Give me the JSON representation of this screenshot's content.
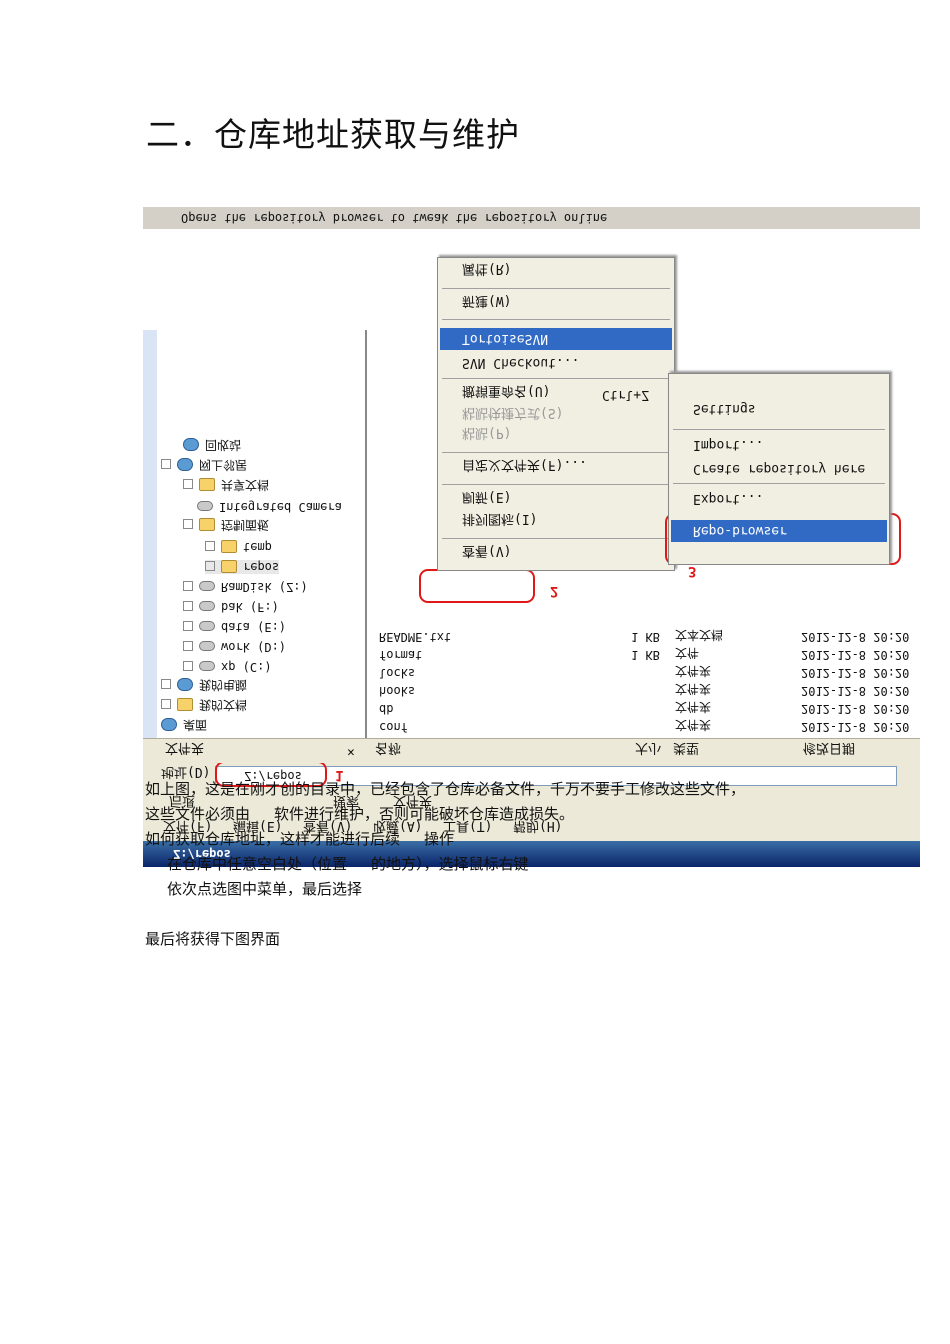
{
  "heading": "二．仓库地址获取与维护",
  "screenshot": {
    "tooltip": "Opens the repository browser to tweak the repository online",
    "titlebar": "Z:/repos",
    "menubar": [
      "文件(F)",
      "编辑(E)",
      "查看(V)",
      "收藏(A)",
      "工具(T)",
      "帮助(H)"
    ],
    "toolbar": [
      "后退",
      "搜索",
      "文件夹"
    ],
    "address_label": "地址(D)",
    "address_value": "Z:/repos",
    "tree_header": "文件夹",
    "tree_close": "×",
    "tree": [
      {
        "label": "回收站",
        "icon": "recycle-icon",
        "type": "net"
      },
      {
        "label": "网上邻居",
        "icon": "network-icon",
        "type": "net"
      },
      {
        "label": "共享文档",
        "icon": "folder-icon",
        "type": "folder"
      },
      {
        "label": "Integrated Camera",
        "icon": "camera-icon",
        "type": "drive"
      },
      {
        "label": "控制面板",
        "icon": "control-panel-icon",
        "type": "folder"
      },
      {
        "label": "temp",
        "icon": "folder-icon",
        "type": "folder"
      },
      {
        "label": "repos",
        "icon": "folder-icon",
        "type": "folder"
      },
      {
        "label": "RamDisk (Z:)",
        "icon": "drive-icon",
        "type": "drive"
      },
      {
        "label": "bak (F:)",
        "icon": "drive-icon",
        "type": "drive"
      },
      {
        "label": "data (E:)",
        "icon": "drive-icon",
        "type": "drive"
      },
      {
        "label": "work (D:)",
        "icon": "drive-icon",
        "type": "drive"
      },
      {
        "label": "xp (C:)",
        "icon": "drive-icon",
        "type": "drive"
      },
      {
        "label": "我的电脑",
        "icon": "computer-icon",
        "type": "net"
      },
      {
        "label": "我的文档",
        "icon": "documents-icon",
        "type": "folder"
      },
      {
        "label": "桌面",
        "icon": "desktop-icon",
        "type": "net"
      }
    ],
    "list_headers": [
      "名称",
      "大小",
      "类型",
      "修改日期"
    ],
    "files": [
      {
        "name": "README.txt",
        "size": "1 KB",
        "type": "文本文档",
        "date": "2012-12-8 20:20"
      },
      {
        "name": "format",
        "size": "1 KB",
        "type": "文件",
        "date": "2012-12-8 20:20"
      },
      {
        "name": "locks",
        "size": "",
        "type": "文件夹",
        "date": "2012-12-8 20:20"
      },
      {
        "name": "hooks",
        "size": "",
        "type": "文件夹",
        "date": "2012-12-8 20:20"
      },
      {
        "name": "db",
        "size": "",
        "type": "文件夹",
        "date": "2012-12-8 20:20"
      },
      {
        "name": "conf",
        "size": "",
        "type": "文件夹",
        "date": "2012-12-8 20:20"
      }
    ],
    "context_menu": [
      {
        "label": "查看(V)",
        "arrow": true
      },
      {
        "label": "排列图标(I)",
        "arrow": true
      },
      {
        "label": "刷新(E)",
        "arrow": false
      },
      {
        "label": "自定义文件夹(F)...",
        "arrow": false
      },
      {
        "label": "粘贴(P)",
        "arrow": false
      },
      {
        "label": "粘贴快捷方式(S)",
        "arrow": false
      },
      {
        "label": "撤销重命名(U)",
        "arrow": false,
        "shortcut": "Ctrl+Z"
      },
      {
        "label": "SVN Checkout...",
        "arrow": false
      },
      {
        "label": "TortoiseSVN",
        "arrow": true,
        "highlight": true
      },
      {
        "label": "新建(W)",
        "arrow": true
      },
      {
        "label": "属性(R)",
        "arrow": false
      }
    ],
    "submenu": [
      {
        "label": "Repo-browser",
        "highlight": true
      },
      {
        "label": "Export..."
      },
      {
        "label": "Create repository here"
      },
      {
        "label": "Import..."
      },
      {
        "label": "Settings"
      }
    ],
    "markers": [
      "1",
      "2",
      "3"
    ]
  },
  "paragraphs": [
    "如上图，这是在刚才创的目录中，已经包含了仓库必备文件，千万不要手工修改这些文件，",
    "这些文件必须由",
    "软件进行维护，否则可能破坏仓库造成损失。",
    "如何获取仓库地址，这样才能进行后续",
    "操作",
    "在仓库中任意空白处（位置",
    "的地方），选择鼠标右键",
    "依次点选图中菜单，最后选择",
    "最后将获得下图界面"
  ]
}
